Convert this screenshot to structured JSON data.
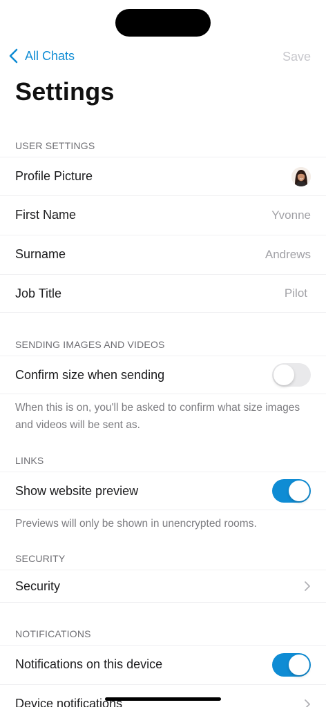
{
  "nav": {
    "back_label": "All Chats",
    "save_label": "Save"
  },
  "title": "Settings",
  "user_settings": {
    "header": "USER SETTINGS",
    "profile_picture_label": "Profile Picture",
    "first_name_label": "First Name",
    "first_name_value": "Yvonne",
    "surname_label": "Surname",
    "surname_value": "Andrews",
    "job_title_label": "Job Title",
    "job_title_value": "Pilot"
  },
  "sending": {
    "header": "SENDING IMAGES AND VIDEOS",
    "confirm_size_label": "Confirm size when sending",
    "confirm_size_on": false,
    "footer": "When this is on, you'll be asked to confirm what size images and videos will be sent as."
  },
  "links": {
    "header": "LINKS",
    "show_preview_label": "Show website preview",
    "show_preview_on": true,
    "footer": "Previews will only be shown in unencrypted rooms."
  },
  "security": {
    "header": "SECURITY",
    "security_label": "Security"
  },
  "notifications": {
    "header": "NOTIFICATIONS",
    "on_device_label": "Notifications on this device",
    "on_device_on": true,
    "device_notifications_label": "Device notifications"
  },
  "colors": {
    "accent": "#0f8cd4",
    "toggle_off": "#e9e9eb"
  }
}
